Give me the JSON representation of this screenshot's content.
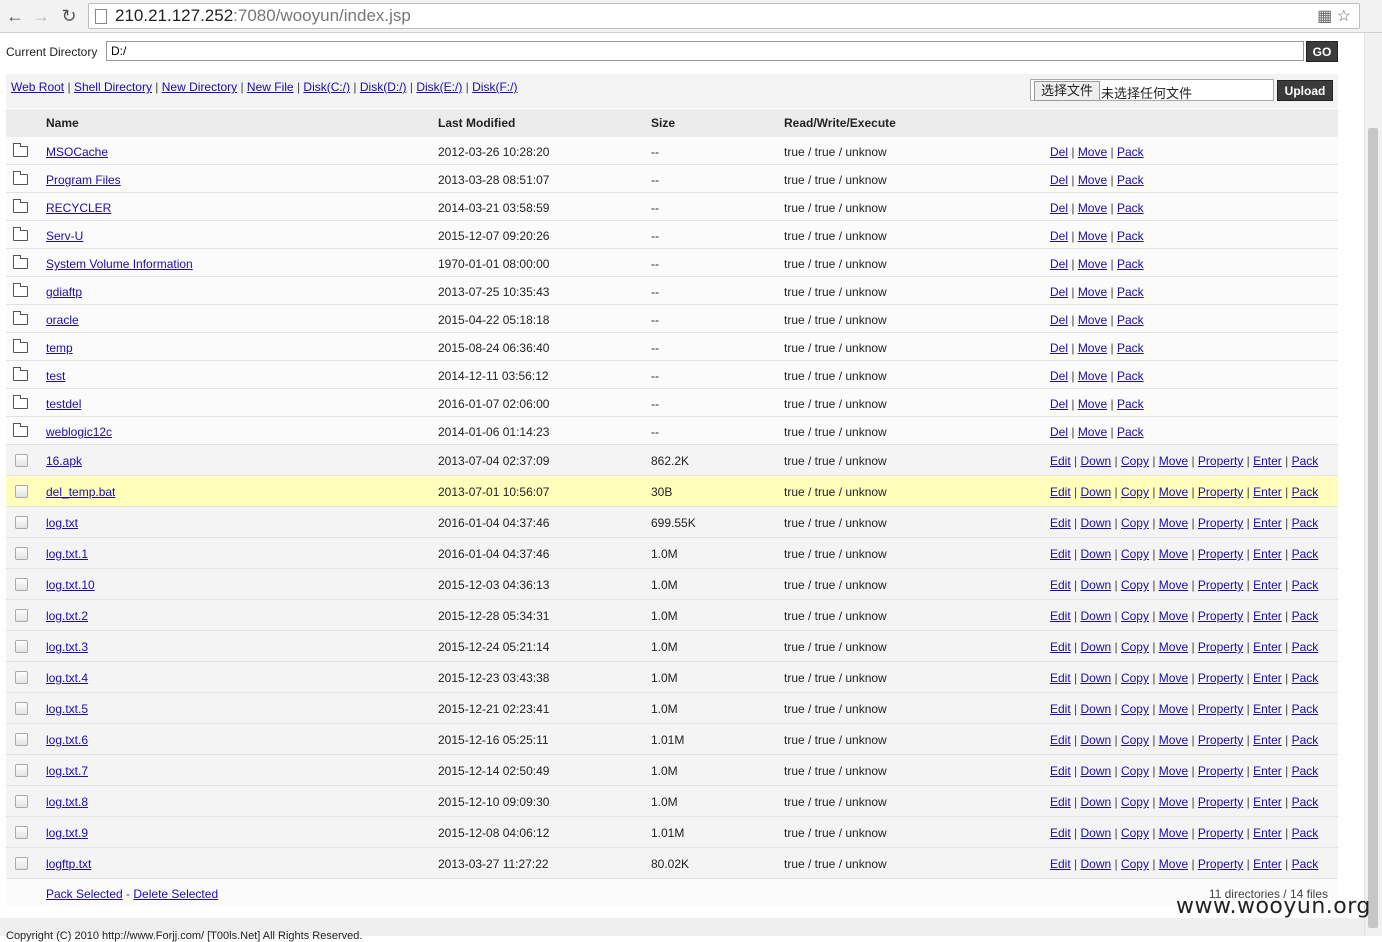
{
  "browser": {
    "url_host": "210.21.127.252",
    "url_rest": ":7080/wooyun/index.jsp"
  },
  "current_directory": {
    "label": "Current Directory",
    "value": "D:/",
    "go_label": "GO"
  },
  "toolbar": {
    "links": [
      "Web Root",
      "Shell Directory",
      "New Directory",
      "New File",
      "Disk(C:/)",
      "Disk(D:/)",
      "Disk(E:/)",
      "Disk(F:/)"
    ],
    "choose_file_label": "选择文件",
    "no_file_text": "未选择任何文件",
    "upload_label": "Upload"
  },
  "table": {
    "headers": {
      "name": "Name",
      "modified": "Last Modified",
      "size": "Size",
      "rwx": "Read/Write/Execute"
    },
    "dir_actions": [
      "Del",
      "Move",
      "Pack"
    ],
    "file_actions": [
      "Edit",
      "Down",
      "Copy",
      "Move",
      "Property",
      "Enter",
      "Pack"
    ],
    "directories": [
      {
        "name": "MSOCache",
        "modified": "2012-03-26 10:28:20",
        "size": "--",
        "rwx": "true / true / unknow"
      },
      {
        "name": "Program Files",
        "modified": "2013-03-28 08:51:07",
        "size": "--",
        "rwx": "true / true / unknow"
      },
      {
        "name": "RECYCLER",
        "modified": "2014-03-21 03:58:59",
        "size": "--",
        "rwx": "true / true / unknow"
      },
      {
        "name": "Serv-U",
        "modified": "2015-12-07 09:20:26",
        "size": "--",
        "rwx": "true / true / unknow"
      },
      {
        "name": "System Volume Information",
        "modified": "1970-01-01 08:00:00",
        "size": "--",
        "rwx": "true / true / unknow"
      },
      {
        "name": "gdiaftp",
        "modified": "2013-07-25 10:35:43",
        "size": "--",
        "rwx": "true / true / unknow"
      },
      {
        "name": "oracle",
        "modified": "2015-04-22 05:18:18",
        "size": "--",
        "rwx": "true / true / unknow"
      },
      {
        "name": "temp",
        "modified": "2015-08-24 06:36:40",
        "size": "--",
        "rwx": "true / true / unknow"
      },
      {
        "name": "test",
        "modified": "2014-12-11 03:56:12",
        "size": "--",
        "rwx": "true / true / unknow"
      },
      {
        "name": "testdel",
        "modified": "2016-01-07 02:06:00",
        "size": "--",
        "rwx": "true / true / unknow"
      },
      {
        "name": "weblogic12c",
        "modified": "2014-01-06 01:14:23",
        "size": "--",
        "rwx": "true / true / unknow"
      }
    ],
    "files": [
      {
        "name": "16.apk",
        "modified": "2013-07-04 02:37:09",
        "size": "862.2K",
        "rwx": "true / true / unknow"
      },
      {
        "name": "del_temp.bat",
        "modified": "2013-07-01 10:56:07",
        "size": "30B",
        "rwx": "true / true / unknow",
        "highlight": true
      },
      {
        "name": "log.txt",
        "modified": "2016-01-04 04:37:46",
        "size": "699.55K",
        "rwx": "true / true / unknow"
      },
      {
        "name": "log.txt.1",
        "modified": "2016-01-04 04:37:46",
        "size": "1.0M",
        "rwx": "true / true / unknow"
      },
      {
        "name": "log.txt.10",
        "modified": "2015-12-03 04:36:13",
        "size": "1.0M",
        "rwx": "true / true / unknow"
      },
      {
        "name": "log.txt.2",
        "modified": "2015-12-28 05:34:31",
        "size": "1.0M",
        "rwx": "true / true / unknow"
      },
      {
        "name": "log.txt.3",
        "modified": "2015-12-24 05:21:14",
        "size": "1.0M",
        "rwx": "true / true / unknow"
      },
      {
        "name": "log.txt.4",
        "modified": "2015-12-23 03:43:38",
        "size": "1.0M",
        "rwx": "true / true / unknow"
      },
      {
        "name": "log.txt.5",
        "modified": "2015-12-21 02:23:41",
        "size": "1.0M",
        "rwx": "true / true / unknow"
      },
      {
        "name": "log.txt.6",
        "modified": "2015-12-16 05:25:11",
        "size": "1.01M",
        "rwx": "true / true / unknow"
      },
      {
        "name": "log.txt.7",
        "modified": "2015-12-14 02:50:49",
        "size": "1.0M",
        "rwx": "true / true / unknow"
      },
      {
        "name": "log.txt.8",
        "modified": "2015-12-10 09:09:30",
        "size": "1.0M",
        "rwx": "true / true / unknow"
      },
      {
        "name": "log.txt.9",
        "modified": "2015-12-08 04:06:12",
        "size": "1.01M",
        "rwx": "true / true / unknow"
      },
      {
        "name": "logftp.txt",
        "modified": "2013-03-27 11:27:22",
        "size": "80.02K",
        "rwx": "true / true / unknow"
      }
    ],
    "footer": {
      "pack_selected": "Pack Selected",
      "separator": " - ",
      "delete_selected": "Delete Selected",
      "summary": "11 directories / 14 files"
    }
  },
  "copyright": "Copyright (C) 2010 http://www.Forjj.com/ [T00ls.Net] All Rights Reserved.",
  "watermark": "www.wooyun.org"
}
